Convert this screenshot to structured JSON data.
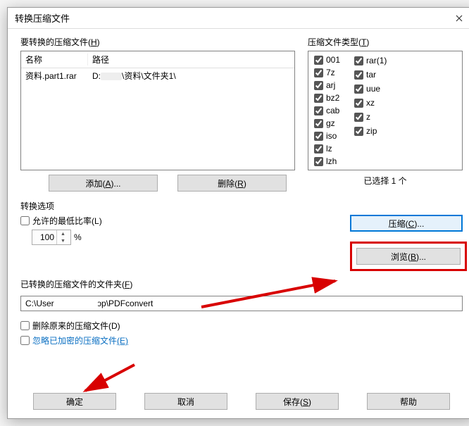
{
  "title": "转换压缩文件",
  "left": {
    "label_pre": "要转换的压缩文件(",
    "label_u": "H",
    "label_post": ")",
    "col_name": "名称",
    "col_path": "路径",
    "rows": [
      {
        "name": "资料.part1.rar",
        "path_pre": "D:",
        "path_mid_hidden": true,
        "path_post": "\\资料\\文件夹1\\"
      }
    ],
    "btn_add_pre": "添加(",
    "btn_add_u": "A",
    "btn_add_post": ")...",
    "btn_del_pre": "删除(",
    "btn_del_u": "R",
    "btn_del_post": ")"
  },
  "right": {
    "label_pre": "压缩文件类型(",
    "label_u": "T",
    "label_post": ")",
    "types_col1": [
      "001",
      "7z",
      "arj",
      "bz2",
      "cab",
      "gz",
      "iso",
      "lz",
      "lzh"
    ],
    "types_col2": [
      "rar(1)",
      "tar",
      "uue",
      "xz",
      "z",
      "zip"
    ],
    "selected_text": "已选择 1 个"
  },
  "opts": {
    "heading": "转换选项",
    "min_ratio_pre": "允许的最低比率(",
    "min_ratio_u": "L",
    "min_ratio_post": ")",
    "min_ratio_value": "100",
    "percent": "%",
    "compress_pre": "压缩(",
    "compress_u": "C",
    "compress_post": ")...",
    "browse_pre": "浏览(",
    "browse_u": "B",
    "browse_post": ")...",
    "folder_label_pre": "已转换的压缩文件的文件夹(",
    "folder_label_u": "F",
    "folder_label_post": ")",
    "folder_path_pre": "C:\\User",
    "folder_path_post": "\\Desktop\\PDFconvert",
    "del_orig_pre": "删除原来的压缩文件(",
    "del_orig_u": "D",
    "del_orig_post": ")",
    "skip_enc_pre": "忽略已加密的压缩文件",
    "skip_enc_u": "(E)"
  },
  "footer": {
    "ok": "确定",
    "cancel": "取消",
    "save_pre": "保存(",
    "save_u": "S",
    "save_post": ")",
    "help": "帮助"
  }
}
